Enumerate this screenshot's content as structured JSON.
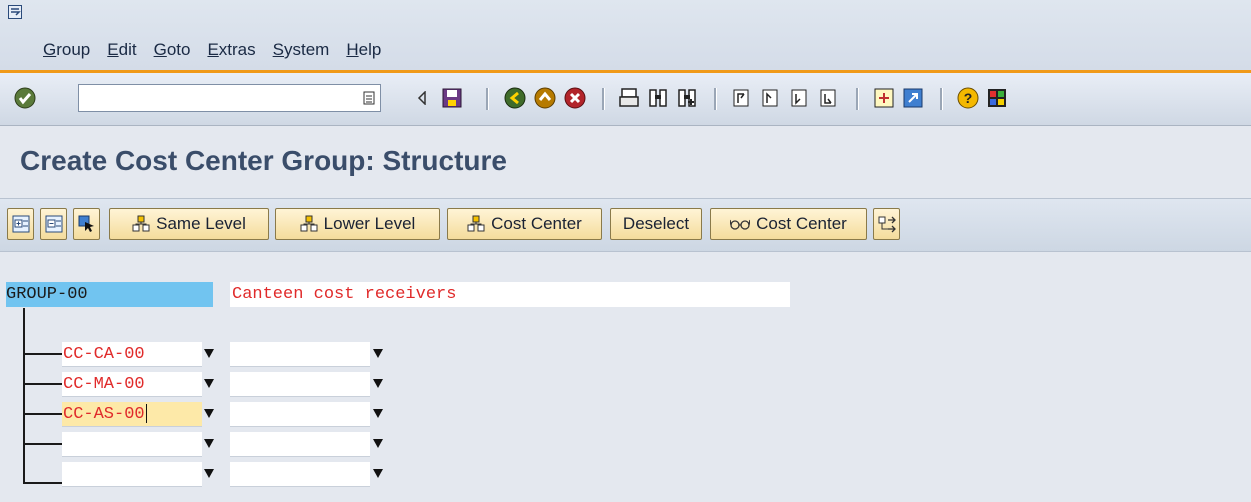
{
  "menu": {
    "items": [
      {
        "label": "Group"
      },
      {
        "label": "Edit"
      },
      {
        "label": "Goto"
      },
      {
        "label": "Extras"
      },
      {
        "label": "System"
      },
      {
        "label": "Help"
      }
    ]
  },
  "toolbar": {
    "command_value": "",
    "icons": [
      "enter-icon",
      "command-field-history-icon",
      "back-arrow-icon",
      "save-icon",
      "back-icon",
      "exit-icon",
      "cancel-icon",
      "print-icon",
      "find-icon",
      "find-next-icon",
      "first-page-icon",
      "previous-page-icon",
      "next-page-icon",
      "last-page-icon",
      "create-session-icon",
      "shortcut-icon",
      "help-icon",
      "customize-layout-icon"
    ]
  },
  "page": {
    "title": "Create Cost Center Group: Structure"
  },
  "app_toolbar": {
    "buttons": [
      {
        "label": "Same Level"
      },
      {
        "label": "Lower Level"
      },
      {
        "label": "Cost Center"
      },
      {
        "label": "Deselect"
      },
      {
        "label": "Cost Center"
      }
    ]
  },
  "tree": {
    "group_id": "GROUP-00",
    "group_description": "Canteen cost receivers",
    "rows": [
      {
        "cost_center": "CC-CA-00",
        "description": ""
      },
      {
        "cost_center": "CC-MA-00",
        "description": ""
      },
      {
        "cost_center": "CC-AS-00",
        "description": ""
      },
      {
        "cost_center": "",
        "description": ""
      },
      {
        "cost_center": "",
        "description": ""
      }
    ]
  },
  "colors": {
    "group_field_bg": "#71c4f0",
    "red_text": "#e02a2a",
    "focus_field_bg": "#fde9a8",
    "menu_accent": "#f09a1a",
    "title_text": "#3a4d6a"
  }
}
